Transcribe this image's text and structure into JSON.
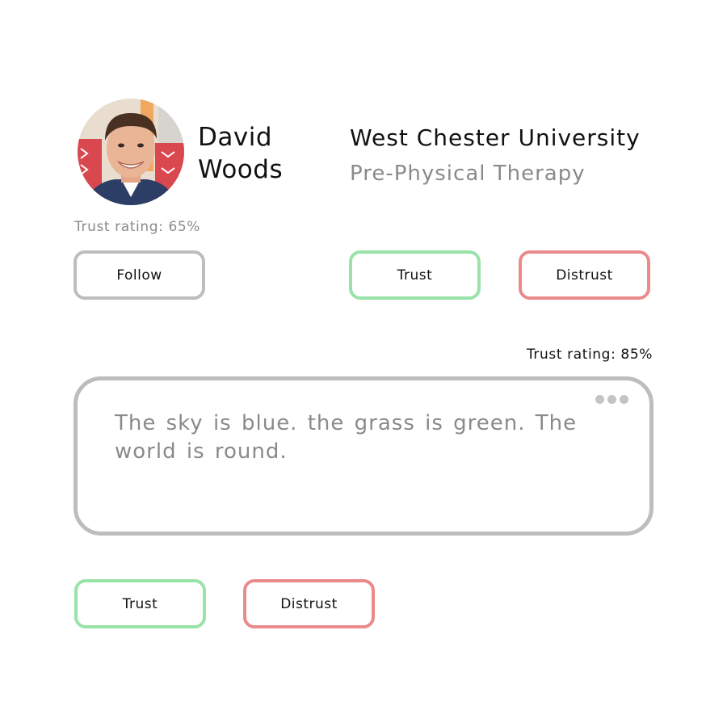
{
  "profile": {
    "first_name": "David",
    "last_name": "Woods",
    "school": "West Chester University",
    "major": "Pre-Physical Therapy",
    "trust_rating_label": "Trust rating: 65%",
    "trust_rating_value": 65,
    "avatar_icon": "user-photo"
  },
  "profile_actions": {
    "follow_label": "Follow",
    "trust_label": "Trust",
    "distrust_label": "Distrust"
  },
  "post": {
    "trust_rating_label": "Trust rating: 85%",
    "trust_rating_value": 85,
    "text": "The sky is blue. the grass is green. The world is round.",
    "menu_icon": "more-dots-icon"
  },
  "post_actions": {
    "trust_label": "Trust",
    "distrust_label": "Distrust"
  },
  "colors": {
    "neutral_border": "#bdbdbd",
    "trust_border": "#99e3a8",
    "distrust_border": "#eb8a8a",
    "secondary_text": "#8a8a8a",
    "primary_text": "#111111"
  }
}
